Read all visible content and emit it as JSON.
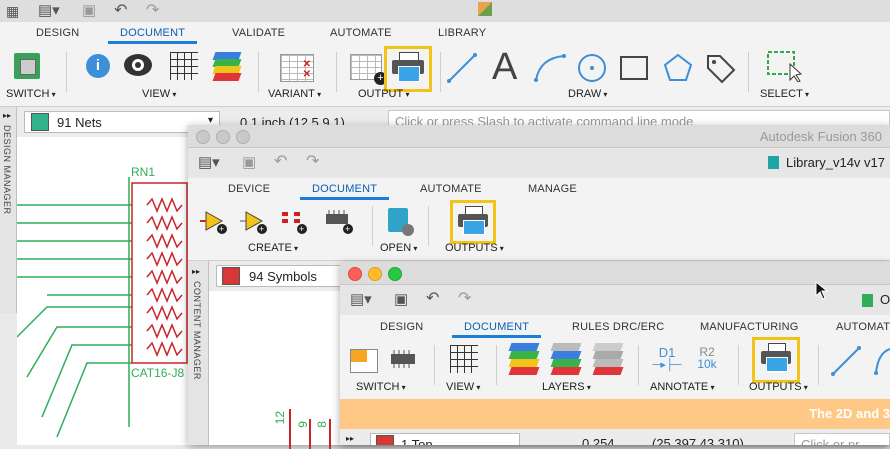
{
  "main": {
    "tabs": [
      {
        "label": "DESIGN"
      },
      {
        "label": "DOCUMENT"
      },
      {
        "label": "VALIDATE"
      },
      {
        "label": "AUTOMATE"
      },
      {
        "label": "LIBRARY"
      }
    ],
    "groups": {
      "switch": "SWITCH",
      "view": "VIEW",
      "variant": "VARIANT",
      "output": "OUTPUT",
      "draw": "DRAW",
      "select": "SELECT"
    },
    "nets_selector": "91 Nets",
    "grid_value": "0.1 inch (12.5 9.1)",
    "command_placeholder": "Click or press Slash to activate command line mode",
    "design_manager": "DESIGN MANAGER",
    "schematic": {
      "part_name": "RN1",
      "part_value": "CAT16-J8"
    }
  },
  "library_window": {
    "app_title": "Autodesk Fusion 360",
    "doc_title": "Library_v14v v17",
    "tabs": [
      {
        "label": "DEVICE"
      },
      {
        "label": "DOCUMENT"
      },
      {
        "label": "AUTOMATE"
      },
      {
        "label": "MANAGE"
      }
    ],
    "groups": {
      "create": "CREATE",
      "open": "OPEN",
      "outputs": "OUTPUTS"
    },
    "symbols_selector": "94 Symbols",
    "content_manager": "CONTENT MANAGER",
    "pins": [
      "12",
      "9",
      "8"
    ]
  },
  "pcb_window": {
    "doc_title": "O",
    "tabs": [
      {
        "label": "DESIGN"
      },
      {
        "label": "DOCUMENT"
      },
      {
        "label": "RULES DRC/ERC"
      },
      {
        "label": "MANUFACTURING"
      },
      {
        "label": "AUTOMAT"
      }
    ],
    "groups": {
      "switch": "SWITCH",
      "view": "VIEW",
      "layers": "LAYERS",
      "annotate": "ANNOTATE",
      "outputs": "OUTPUTS"
    },
    "annotate_labels": {
      "d1": "D1",
      "r2": "R2",
      "r2_value": "10k"
    },
    "banner": "The 2D and 3",
    "layer_selector": "1 Top",
    "coord_a": "0.254",
    "coord_b": "(25.397 43.310)",
    "command_placeholder": "Click or pr"
  },
  "colors": {
    "accent": "#1c7ed6",
    "highlight": "#f2c318",
    "schematic_net": "#2eae57",
    "schematic_part": "#c8242a",
    "banner": "#ffc886"
  }
}
